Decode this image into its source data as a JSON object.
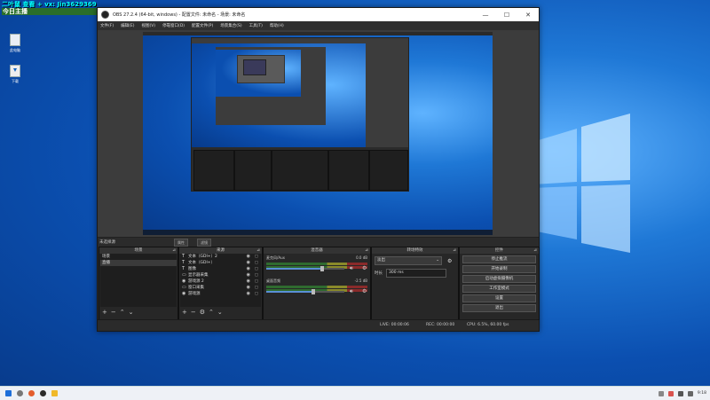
{
  "overlay": {
    "line1": "二叶鼠 查看 + vx: Jin3629369",
    "line2": "今日主播"
  },
  "desktop_icons": [
    {
      "label": "此电脑"
    },
    {
      "label": "下载"
    }
  ],
  "window": {
    "title": "OBS 27.2.4 (64-bit, windows) - 配置文件: 未命名 - 场景: 未命名",
    "buttons": {
      "minimize": "—",
      "maximize": "☐",
      "close": "✕"
    }
  },
  "menu": [
    "文件(F)",
    "编辑(E)",
    "视图(V)",
    "停靠窗口(D)",
    "配置文件(P)",
    "场景集合(S)",
    "工具(T)",
    "帮助(H)"
  ],
  "scenebar": {
    "label": "未选择源",
    "props_button": "属性",
    "filters_button": "滤镜"
  },
  "scenes": {
    "title": "场景",
    "items": [
      {
        "label": "场景",
        "selected": false
      },
      {
        "label": "直播",
        "selected": true
      }
    ]
  },
  "sources": {
    "title": "来源",
    "items": [
      {
        "icon": "T",
        "label": "文本（GDI+）2"
      },
      {
        "icon": "T",
        "label": "文本（GDI+）"
      },
      {
        "icon": "T",
        "label": "图像"
      },
      {
        "icon": "▭",
        "label": "显示器采集"
      },
      {
        "icon": "◉",
        "label": "游戏源 2"
      },
      {
        "icon": "▭",
        "label": "窗口采集"
      },
      {
        "icon": "◉",
        "label": "游戏源"
      }
    ]
  },
  "mixer": {
    "title": "混音器",
    "tracks": [
      {
        "name": "麦克风/Aux",
        "db": "0.0 dB",
        "level": 0.72
      },
      {
        "name": "桌面音频",
        "db": "-2.5 dB",
        "level": 0.6
      }
    ]
  },
  "transitions": {
    "title": "转场特效",
    "selected": "淡出",
    "duration_label": "时长",
    "duration_value": "300 ms"
  },
  "controls": {
    "title": "控件",
    "buttons": [
      "停止推流",
      "开始录制",
      "启动虚拟摄像机",
      "工作室模式",
      "设置",
      "退出"
    ]
  },
  "status": {
    "live": "LIVE: 00:00:06",
    "rec": "REC: 00:00:00",
    "cpu": "CPU: 6.5%, 60.00 fps"
  },
  "taskbar": {
    "time": "9:18"
  },
  "colors": {
    "desktop": "#0b4fb0",
    "obs_bg": "#2b2b2b",
    "panel": "#272727",
    "accent": "#5a8fd6"
  }
}
